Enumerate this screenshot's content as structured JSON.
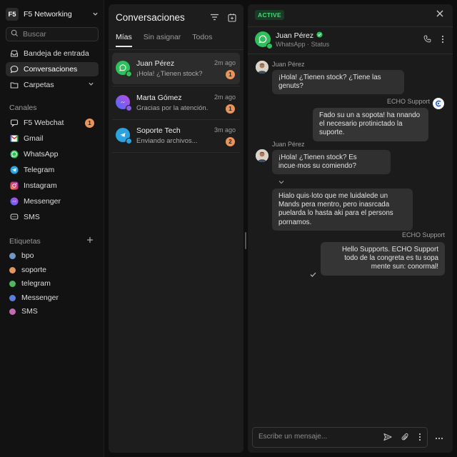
{
  "org": {
    "initials": "F5",
    "name": "F5 Networking"
  },
  "search": {
    "placeholder": "Buscar"
  },
  "nav": [
    {
      "label": "Bandeja de entrada",
      "icon": "inbox-icon"
    },
    {
      "label": "Conversaciones",
      "icon": "chat-bubble-icon",
      "active": true
    },
    {
      "label": "Carpetas",
      "icon": "folder-icon"
    }
  ],
  "channels_title": "Canales",
  "channels": [
    {
      "label": "F5 Webchat",
      "icon": "webchat-icon",
      "badge": "1"
    },
    {
      "label": "Gmail",
      "icon": "gmail-icon"
    },
    {
      "label": "WhatsApp",
      "icon": "whatsapp-icon"
    },
    {
      "label": "Telegram",
      "icon": "telegram-icon"
    },
    {
      "label": "Instagram",
      "icon": "instagram-icon"
    },
    {
      "label": "Messenger",
      "icon": "messenger-icon"
    },
    {
      "label": "SMS",
      "icon": "sms-icon"
    }
  ],
  "tags_title": "Etiquetas",
  "tags": [
    {
      "label": "bpo",
      "color": "#6f98c6"
    },
    {
      "label": "soporte",
      "color": "#e8945a"
    },
    {
      "label": "telegram",
      "color": "#4cba5c"
    },
    {
      "label": "Messenger",
      "color": "#5b7fe0"
    },
    {
      "label": "SMS",
      "color": "#c568b8"
    }
  ],
  "list": {
    "title": "Conversaciones",
    "tabs": [
      "Mías",
      "Sin asignar",
      "Todos"
    ],
    "conversations": [
      {
        "name": "Juan Pérez",
        "preview": "¡Hola! ¿Tienen stock?",
        "time": "2m ago",
        "badge": "1",
        "channel": "whatsapp"
      },
      {
        "name": "Marta Gómez",
        "preview": "Gracias por la atención.",
        "time": "2m ago",
        "badge": "1",
        "channel": "messenger"
      },
      {
        "name": "Soporte Tech",
        "preview": "Enviando archivos...",
        "time": "3m ago",
        "badge": "2",
        "channel": "telegram"
      }
    ]
  },
  "chat": {
    "status": "ACTIVE",
    "contact": {
      "name": "Juan Pérez",
      "channel": "WhatsApp",
      "status": "Status",
      "separator": "·"
    },
    "messages": [
      {
        "sender": "Juan Pérez",
        "text": "¡Hola! ¿Tienen stock? ¿Tiene las genuts?"
      },
      {
        "sender": "ECHO Support",
        "text": "Fado su un a sopota! ha nnando el necesario protinictado la suporte."
      },
      {
        "sender": "Juan Pérez",
        "text": "¡Hola! ¿Tienen stock? Es incue·mos su comiendo?"
      },
      {
        "sender": "",
        "text": "Hialo quis·loto que me luidalede un Mands pera mentro, pero inasrcada puelarda lo hasta aki para el persons pornamos."
      },
      {
        "sender": "ECHO Support",
        "text": "Hello Supports. ECHO Support todo de la congreta es tu sopa mente sun: conormal!"
      }
    ],
    "composer_placeholder": "Escribe un mensaje..."
  }
}
